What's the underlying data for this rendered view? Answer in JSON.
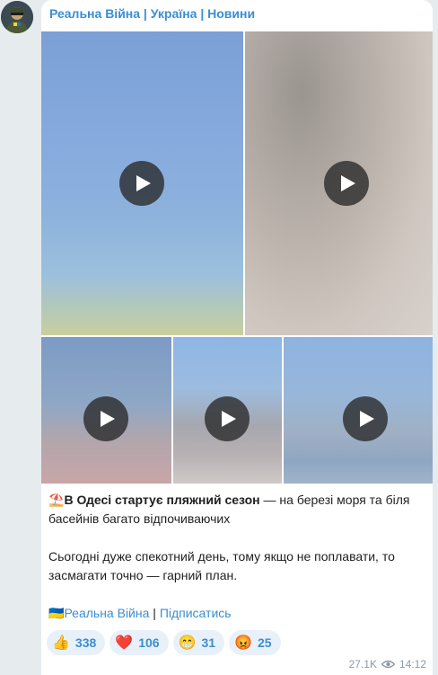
{
  "channel": {
    "name": "Реальна Війна | Україна | Новини"
  },
  "media": {
    "videos": [
      {
        "name": "video-1"
      },
      {
        "name": "video-2"
      },
      {
        "name": "video-3"
      },
      {
        "name": "video-4"
      },
      {
        "name": "video-5"
      }
    ]
  },
  "caption": {
    "emoji": "⛱️",
    "headline_bold": "В Одесі стартує пляжний сезон",
    "headline_rest": " — на березі моря та біля басейнів багато відпочиваючих",
    "paragraph2": "Сьогодні дуже спекотний день, тому якщо не поплавати, то засмагати точно — гарний план.",
    "flag": "🇺🇦",
    "channel_link": "Реальна Війна",
    "separator": " | ",
    "subscribe_link": "Підписатись"
  },
  "reactions": [
    {
      "emoji": "👍",
      "count": "338"
    },
    {
      "emoji": "❤️",
      "count": "106"
    },
    {
      "emoji": "😁",
      "count": "31"
    },
    {
      "emoji": "😡",
      "count": "25"
    }
  ],
  "meta": {
    "views": "27.1K",
    "time": "14:12"
  },
  "colors": {
    "accent": "#3a8ed0",
    "reaction_bg": "#e8f1fa",
    "meta": "#8b9aa6"
  }
}
